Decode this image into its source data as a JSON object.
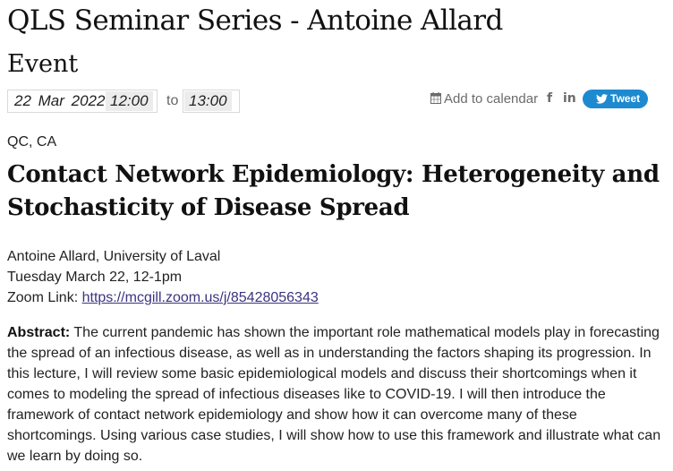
{
  "header": {
    "title": "QLS Seminar Series - Antoine Allard",
    "event_label": "Event"
  },
  "event_time": {
    "date": "22  Mar  2022",
    "start_time": "12:00",
    "to_label": "to",
    "end_time": "13:00"
  },
  "share": {
    "calendar_label": "Add to calendar",
    "calendar_icon": "calendar-icon",
    "facebook_glyph": "f",
    "linkedin_glyph": "in",
    "tweet_label": "Tweet",
    "tweet_color": "#1d8ad0"
  },
  "location": "QC, CA",
  "talk_title": "Contact Network Epidemiology: Heterogeneity and Stochasticity of Disease Spread",
  "details": {
    "speaker": "Antoine Allard, University of Laval",
    "when": "Tuesday March 22, 12-1pm",
    "zoom_label": "Zoom Link: ",
    "zoom_url": "https://mcgill.zoom.us/j/85428056343"
  },
  "abstract": {
    "label": "Abstract:",
    "text": " The current pandemic has shown the important role mathematical models play in forecasting the spread of an infectious disease, as well as in understanding the factors shaping its progression. In this lecture, I will review some basic epidemiological models and discuss their shortcomings when it comes to modeling the spread of infectious diseases like to COVID-19. I will then introduce the framework of contact network epidemiology and show how it can overcome many of these shortcomings. Using various case studies, I will show how to use this framework and illustrate what can we learn by doing so."
  }
}
